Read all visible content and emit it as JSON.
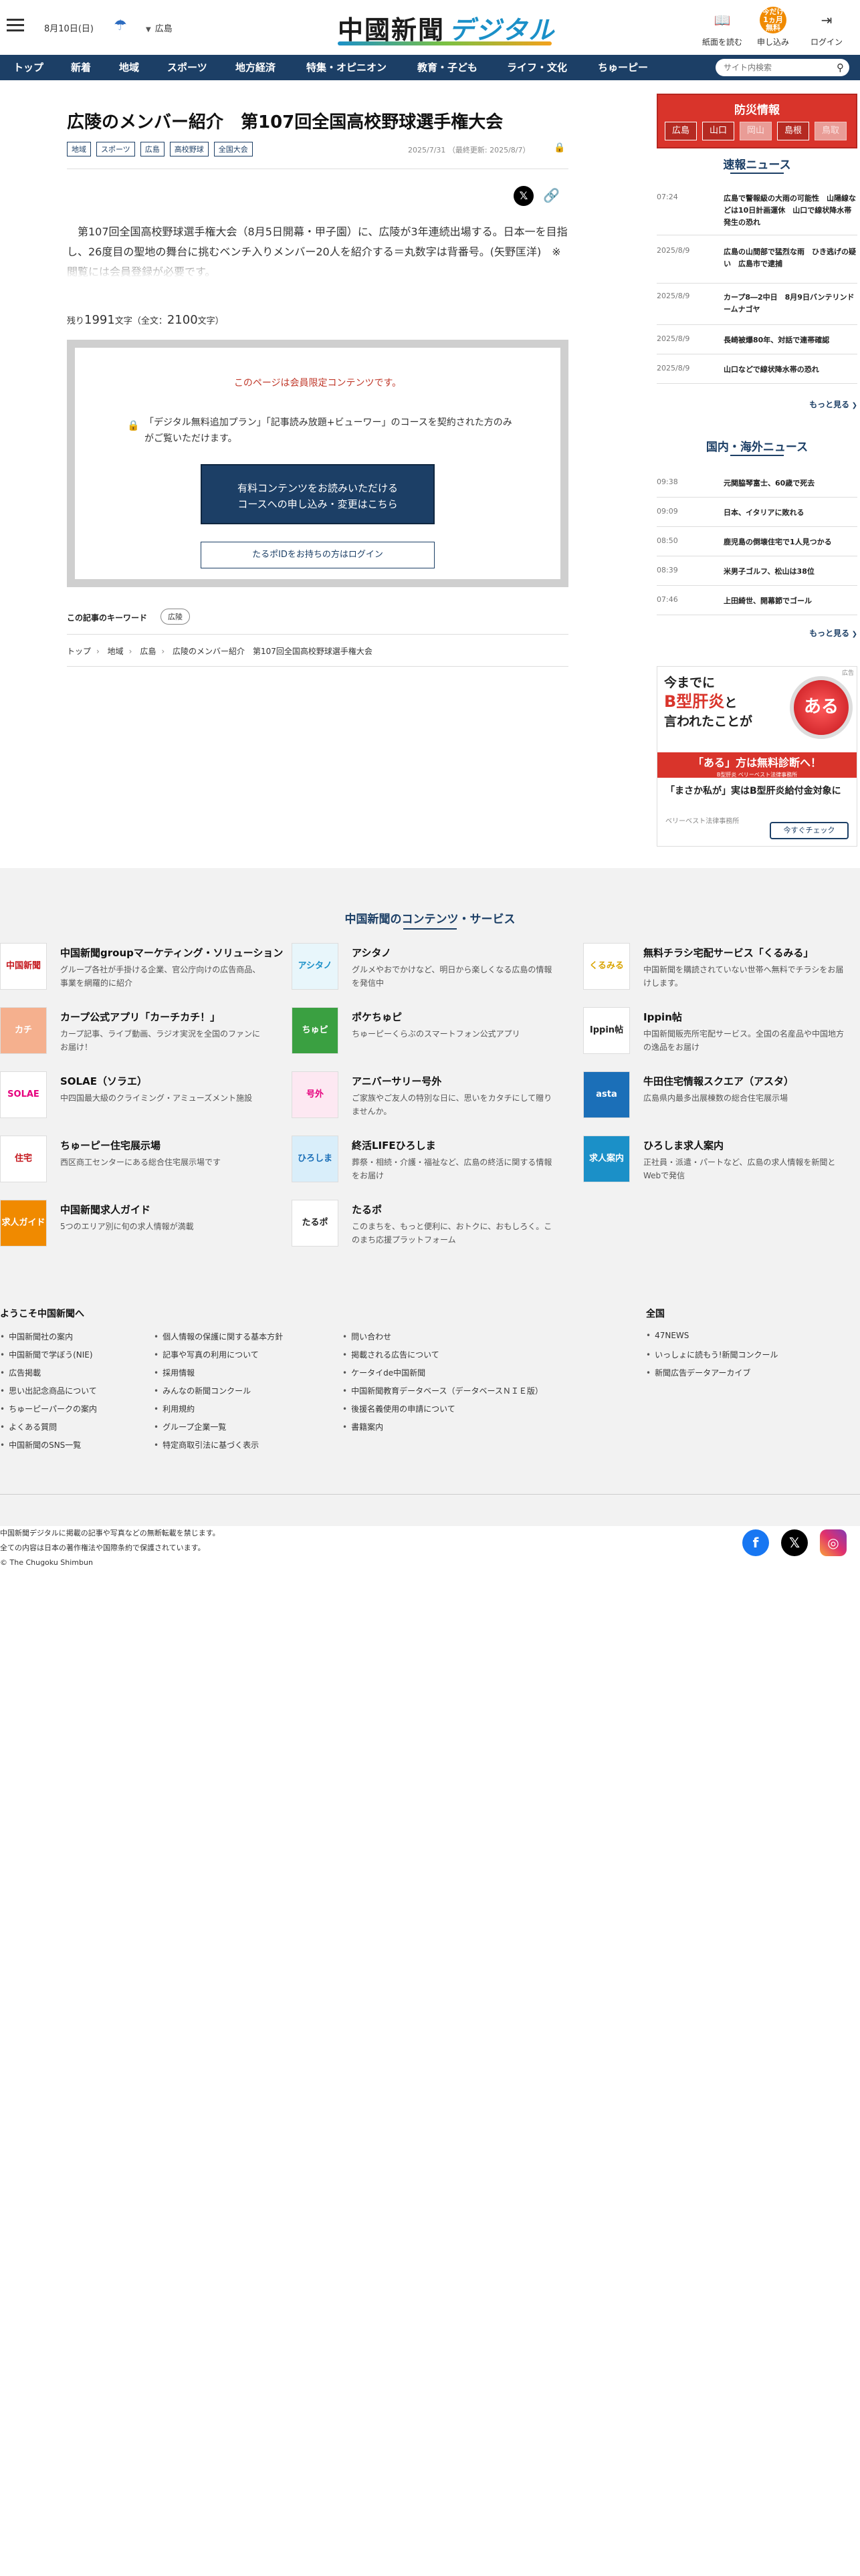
{
  "header": {
    "date": "8月10日(日)",
    "region": "広島",
    "logo_main": "中國新聞",
    "logo_sub": "デジタル",
    "buttons": {
      "paper": "紙面を読む",
      "subscribe": "申し込み",
      "subscribe_badge": "今だけ1ヵ月無料",
      "login": "ログイン"
    }
  },
  "nav": {
    "items": [
      "トップ",
      "新着",
      "地域",
      "スポーツ",
      "地方経済",
      "特集・オピニオン",
      "教育・子ども",
      "ライフ・文化",
      "ちゅーピー"
    ],
    "search_placeholder": "サイト内検索"
  },
  "article": {
    "title": "広陵のメンバー紹介　第107回全国高校野球選手権大会",
    "tags": [
      "地域",
      "スポーツ",
      "広島",
      "高校野球",
      "全国大会"
    ],
    "published": "2025/7/31",
    "updated": "（最終更新: 2025/8/7）",
    "lead": "第107回全国高校野球選手権大会（8月5日開幕・甲子園）に、広陵が3年連続出場する。日本一を目指し、26度目の聖地の舞台に挑むベンチ入りメンバー20人を紹介する＝丸数字は背番号。(矢野匡洋)　※閲覧には会員登録が必要です。",
    "remain_prefix": "残り",
    "remain_count": "1991",
    "remain_mid": "文字（全文：",
    "total_count": "2100",
    "remain_suffix": "文字）"
  },
  "paywall": {
    "title": "このページは会員限定コンテンツです。",
    "message": "「デジタル無料追加プラン」「記事読み放題+ビューワー」のコースを契約された方のみがご覧いただけます。",
    "cta_line1": "有料コンテンツをお読みいただける",
    "cta_line2": "コースへの申し込み・変更はこちら",
    "login_button": "たるポIDをお持ちの方はログイン"
  },
  "keywords": {
    "label": "この記事のキーワード",
    "items": [
      "広陵"
    ]
  },
  "breadcrumb": [
    "トップ",
    "地域",
    "広島",
    "広陵のメンバー紹介　第107回全国高校野球選手権大会"
  ],
  "sidebar": {
    "disaster_title": "防災情報",
    "prefs": [
      {
        "name": "広島",
        "active": true
      },
      {
        "name": "山口",
        "active": true
      },
      {
        "name": "岡山",
        "active": false
      },
      {
        "name": "島根",
        "active": true
      },
      {
        "name": "鳥取",
        "active": false
      }
    ],
    "breaking_title": "速報ニュース",
    "breaking": [
      {
        "time": "07:24",
        "text": "広島で警報級の大雨の可能性　山陽線などは10日計画運休　山口で線状降水帯発生の恐れ"
      },
      {
        "time": "2025/8/9",
        "text": "広島の山間部で猛烈な雨　ひき逃げの疑い　広島市で逮捕"
      },
      {
        "time": "2025/8/9",
        "text": "カープ8―2中日　8月9日バンテリンドームナゴヤ"
      },
      {
        "time": "2025/8/9",
        "text": "長崎被爆80年、対話で連帯確認"
      },
      {
        "time": "2025/8/9",
        "text": "山口などで線状降水帯の恐れ"
      }
    ],
    "breaking_more": "もっと見る",
    "national_title": "国内・海外ニュース",
    "national": [
      {
        "time": "09:38",
        "text": "元関脇琴富士、60歳で死去"
      },
      {
        "time": "09:09",
        "text": "日本、イタリアに敗れる"
      },
      {
        "time": "08:50",
        "text": "鹿児島の倒壊住宅で1人見つかる"
      },
      {
        "time": "08:39",
        "text": "米男子ゴルフ、松山は38位"
      },
      {
        "time": "07:46",
        "text": "上田綺世、開幕節でゴール"
      }
    ],
    "national_more": "もっと見る",
    "ad": {
      "flag": "広告",
      "head1": "今までに",
      "head2": "B型肝炎",
      "head3": "と",
      "head4": "言われたことが",
      "button": "ある",
      "red_line": "「ある」方は無料診断へ！",
      "red_sub": "B型肝炎 ベリーベスト法律事務所",
      "text": "「まさか私が」実はB型肝炎給付金対象に",
      "small": "ベリーベスト法律事務所",
      "cta": "今すぐチェック"
    }
  },
  "footer": {
    "services_title": "中国新聞のコンテンツ・サービス",
    "services": [
      {
        "name": "中国新聞groupマーケティング・ソリューション",
        "desc": "グループ各社が手掛ける企業、官公庁向けの広告商品、事業を網羅的に紹介",
        "icon": "中国新聞",
        "color": "#c4161c",
        "bg": "#fff"
      },
      {
        "name": "アシタノ",
        "desc": "グルメやおでかけなど、明日から楽しくなる広島の情報を発信中",
        "icon": "アシタノ",
        "color": "#1b90c8",
        "bg": "#e8f6fb"
      },
      {
        "name": "無料チラシ宅配サービス「くるみる」",
        "desc": "中国新聞を購読されていない世帯へ無料でチラシをお届けします。",
        "icon": "くるみる",
        "color": "#d9a400",
        "bg": "#fff"
      },
      {
        "name": "カープ公式アプリ「カーチカチ！」",
        "desc": "カープ記事、ライブ動画、ラジオ実況を全国のファンにお届け！",
        "icon": "カチ",
        "color": "#fff",
        "bg": "#f5b08e"
      },
      {
        "name": "ポケちゅピ",
        "desc": "ちゅーピーくらぶのスマートフォン公式アプリ",
        "icon": "ちゅピ",
        "color": "#fff",
        "bg": "#3aa041"
      },
      {
        "name": "Ippin帖",
        "desc": "中国新聞販売所宅配サービス。全国の名産品や中国地方の逸品をお届け",
        "icon": "Ippin帖",
        "color": "#222",
        "bg": "#fff"
      },
      {
        "name": "SOLAE（ソラエ）",
        "desc": "中四国最大級のクライミング・アミューズメント施設",
        "icon": "SOLAE",
        "color": "#e6007e",
        "bg": "#fff"
      },
      {
        "name": "アニバーサリー号外",
        "desc": "ご家族やご友人の特別な日に、思いをカタチにして贈りませんか。",
        "icon": "号外",
        "color": "#e6007e",
        "bg": "#fde8f2"
      },
      {
        "name": "牛田住宅情報スクエア（アスタ）",
        "desc": "広島県内最多出展棟数の総合住宅展示場",
        "icon": "asta",
        "color": "#fff",
        "bg": "#1b6fb8"
      },
      {
        "name": "ちゅーピー住宅展示場",
        "desc": "西区商工センターにある総合住宅展示場です",
        "icon": "住宅",
        "color": "#c4161c",
        "bg": "#fff"
      },
      {
        "name": "終活LIFEひろしま",
        "desc": "葬祭・相続・介護・福祉など、広島の終活に関する情報をお届け",
        "icon": "ひろしま",
        "color": "#1b6fb8",
        "bg": "#d9eefa"
      },
      {
        "name": "ひろしま求人案内",
        "desc": "正社員・派遣・パートなど、広島の求人情報を新聞とWebで発信",
        "icon": "求人案内",
        "color": "#fff",
        "bg": "#1b90c8"
      },
      {
        "name": "中国新聞求人ガイド",
        "desc": "5つのエリア別に旬の求人情報が満載",
        "icon": "求人ガイド",
        "color": "#fff",
        "bg": "#f08a00"
      },
      {
        "name": "たるポ",
        "desc": "このまちを、もっと便利に、おトクに、おもしろく。このまち応援プラットフォーム",
        "icon": "たるポ",
        "color": "#222",
        "bg": "#fff"
      }
    ],
    "welcome_title": "ようこそ中国新聞へ",
    "col1": [
      "中国新聞社の案内",
      "中国新聞で学ぼう(NIE)",
      "広告掲載",
      "思い出記念商品について",
      "ちゅーピーパークの案内",
      "よくある質問",
      "中国新聞のSNS一覧"
    ],
    "col2": [
      "個人情報の保護に関する基本方針",
      "記事や写真の利用について",
      "採用情報",
      "みんなの新聞コンクール",
      "利用規約",
      "グループ企業一覧",
      "特定商取引法に基づく表示"
    ],
    "col3": [
      "問い合わせ",
      "掲載される広告について",
      "ケータイde中国新聞",
      "中国新聞教育データベース（データベースＮＩＥ版）",
      "後援名義使用の申請について",
      "書籍案内"
    ],
    "national_title": "全国",
    "col4": [
      "47NEWS",
      "いっしょに読もう!新聞コンクール",
      "新聞広告データアーカイブ"
    ],
    "copy1": "中国新聞デジタルに掲載の記事や写真などの無断転載を禁じます。",
    "copy2": "全ての内容は日本の著作権法や国際条約で保護されています。",
    "copy3": "© The Chugoku Shimbun"
  }
}
